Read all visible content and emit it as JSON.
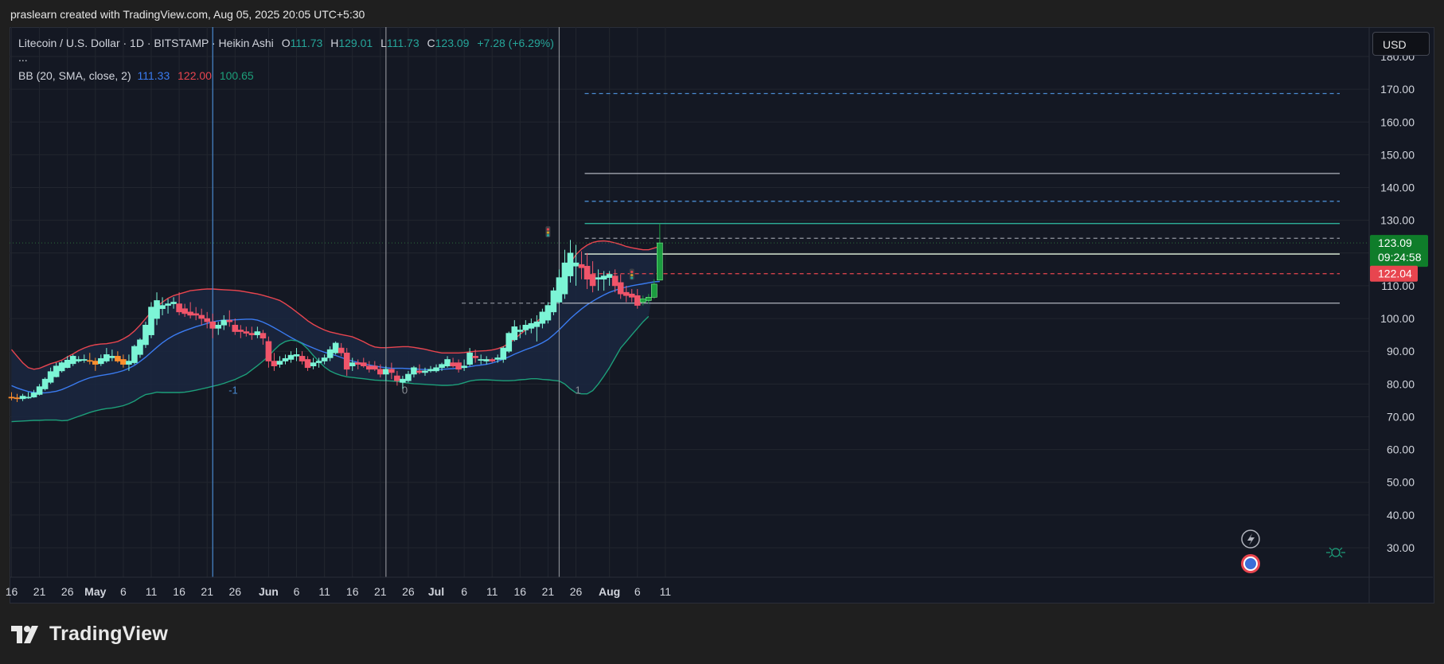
{
  "header": {
    "credit": "praslearn created with TradingView.com, Aug 05, 2025 20:05 UTC+5:30"
  },
  "legend": {
    "symbol": "Litecoin / U.S. Dollar · 1D · BITSTAMP · Heikin Ashi",
    "o_label": "O",
    "o": "111.73",
    "h_label": "H",
    "h": "129.01",
    "l_label": "L",
    "l": "111.73",
    "c_label": "C",
    "c": "123.09",
    "change": "+7.28 (+6.29%)",
    "more": "...",
    "bb_label": "BB (20, SMA, close, 2)",
    "bb_basis": "111.33",
    "bb_upper": "122.00",
    "bb_lower": "100.65"
  },
  "currency_button": "USD",
  "price_badges": {
    "last": "123.09",
    "countdown": "09:24:58",
    "upper": "122.04"
  },
  "brand": "TradingView",
  "colors": {
    "bg": "#141823",
    "up": "#7cf5d6",
    "down": "#f0556a",
    "up_strong": "#1b9c3f",
    "orange": "#ff8f2e",
    "bb_upper": "#e8454f",
    "bb_basis": "#3a7bf0",
    "bb_lower": "#1d9f7a",
    "badge_green": "#0f7d2a",
    "badge_red": "#e8454f"
  },
  "chart_data": {
    "type": "candlestick",
    "chart_style": "Heikin Ashi",
    "ylim": [
      21,
      189
    ],
    "y_ticks": [
      "30.00",
      "40.00",
      "50.00",
      "60.00",
      "70.00",
      "80.00",
      "90.00",
      "100.00",
      "110.00",
      "120.00",
      "130.00",
      "140.00",
      "150.00",
      "160.00",
      "170.00",
      "180.00"
    ],
    "x_ticks": [
      "16",
      "21",
      "26",
      "May",
      "6",
      "11",
      "16",
      "21",
      "26",
      "Jun",
      "6",
      "11",
      "16",
      "21",
      "26",
      "Jul",
      "6",
      "11",
      "16",
      "21",
      "26",
      "Aug",
      "6",
      "11"
    ],
    "x_tick_dates": [
      "2025-04-16",
      "2025-04-21",
      "2025-04-26",
      "2025-05-01",
      "2025-05-06",
      "2025-05-11",
      "2025-05-16",
      "2025-05-21",
      "2025-05-26",
      "2025-06-01",
      "2025-06-06",
      "2025-06-11",
      "2025-06-16",
      "2025-06-21",
      "2025-06-26",
      "2025-07-01",
      "2025-07-06",
      "2025-07-11",
      "2025-07-16",
      "2025-07-21",
      "2025-07-26",
      "2025-08-01",
      "2025-08-06",
      "2025-08-11"
    ],
    "first_date": "2025-04-16",
    "candles": [
      [
        76.0,
        77.5,
        75.0,
        75.8
      ],
      [
        75.8,
        77.0,
        74.5,
        75.5
      ],
      [
        75.5,
        77.0,
        74.8,
        76.3
      ],
      [
        76.0,
        77.5,
        75.5,
        76.0
      ],
      [
        76.0,
        78.2,
        75.8,
        77.3
      ],
      [
        76.8,
        80.0,
        76.5,
        79.2
      ],
      [
        78.5,
        82.0,
        78.0,
        81.5
      ],
      [
        80.5,
        85.0,
        80.0,
        83.8
      ],
      [
        82.2,
        86.5,
        82.0,
        85.5
      ],
      [
        84.0,
        87.0,
        83.5,
        86.5
      ],
      [
        85.0,
        88.5,
        84.8,
        87.3
      ],
      [
        86.2,
        89.0,
        85.5,
        88.5
      ],
      [
        87.0,
        88.5,
        86.5,
        87.5
      ],
      [
        87.5,
        89.0,
        86.5,
        87.5
      ],
      [
        87.2,
        89.5,
        86.0,
        87.0
      ],
      [
        87.0,
        88.0,
        84.0,
        86.0
      ],
      [
        86.2,
        89.0,
        85.5,
        87.8
      ],
      [
        87.0,
        91.0,
        86.5,
        89.0
      ],
      [
        88.0,
        90.5,
        87.0,
        88.5
      ],
      [
        88.5,
        90.0,
        86.5,
        87.0
      ],
      [
        87.5,
        89.0,
        85.0,
        86.0
      ],
      [
        86.0,
        89.0,
        84.0,
        87.0
      ],
      [
        86.5,
        92.0,
        86.0,
        91.5
      ],
      [
        89.0,
        94.0,
        88.0,
        93.5
      ],
      [
        92.0,
        99.0,
        91.0,
        98.0
      ],
      [
        95.0,
        105.0,
        94.0,
        103.5
      ],
      [
        100.0,
        108.0,
        98.0,
        105.5
      ],
      [
        103.0,
        106.5,
        101.0,
        104.0
      ],
      [
        104.0,
        106.0,
        101.5,
        104.5
      ],
      [
        104.5,
        106.5,
        103.0,
        105.0
      ],
      [
        104.5,
        108.0,
        101.0,
        102.0
      ],
      [
        103.0,
        104.5,
        100.5,
        101.5
      ],
      [
        102.0,
        105.0,
        100.0,
        101.0
      ],
      [
        101.5,
        103.5,
        99.5,
        101.0
      ],
      [
        101.0,
        103.0,
        98.0,
        100.0
      ],
      [
        100.0,
        102.0,
        97.0,
        99.0
      ],
      [
        99.0,
        101.5,
        94.0,
        97.0
      ],
      [
        97.0,
        99.0,
        95.0,
        98.0
      ],
      [
        98.0,
        101.0,
        96.5,
        99.5
      ],
      [
        99.5,
        102.5,
        97.5,
        99.0
      ],
      [
        98.0,
        100.0,
        95.0,
        96.0
      ],
      [
        96.5,
        98.0,
        94.0,
        96.0
      ],
      [
        96.0,
        97.5,
        94.5,
        95.5
      ],
      [
        95.5,
        97.5,
        93.5,
        95.0
      ],
      [
        95.0,
        97.5,
        94.0,
        96.0
      ],
      [
        95.5,
        96.5,
        92.0,
        94.0
      ],
      [
        93.0,
        94.5,
        85.0,
        87.0
      ],
      [
        87.0,
        89.5,
        84.0,
        85.5
      ],
      [
        86.0,
        88.5,
        85.0,
        87.0
      ],
      [
        87.0,
        89.0,
        86.0,
        87.8
      ],
      [
        87.5,
        90.0,
        86.5,
        88.8
      ],
      [
        88.5,
        91.0,
        87.0,
        89.0
      ],
      [
        88.5,
        90.0,
        86.0,
        87.0
      ],
      [
        87.5,
        88.5,
        84.0,
        85.0
      ],
      [
        85.5,
        88.0,
        84.5,
        86.5
      ],
      [
        86.5,
        88.0,
        85.0,
        87.0
      ],
      [
        87.0,
        89.0,
        86.0,
        88.0
      ],
      [
        88.0,
        91.5,
        87.0,
        90.5
      ],
      [
        89.5,
        93.0,
        89.0,
        92.5
      ],
      [
        91.0,
        92.5,
        88.5,
        89.5
      ],
      [
        89.5,
        91.0,
        82.5,
        84.5
      ],
      [
        85.5,
        88.0,
        84.0,
        86.5
      ],
      [
        86.5,
        87.5,
        84.5,
        86.0
      ],
      [
        86.5,
        88.0,
        85.0,
        85.5
      ],
      [
        85.5,
        87.0,
        83.5,
        84.5
      ],
      [
        85.5,
        87.0,
        84.0,
        84.5
      ],
      [
        84.5,
        86.0,
        82.0,
        83.0
      ],
      [
        83.0,
        85.5,
        81.0,
        84.5
      ],
      [
        84.5,
        86.5,
        81.5,
        83.5
      ],
      [
        82.5,
        84.0,
        79.5,
        81.0
      ],
      [
        80.5,
        82.5,
        78.5,
        81.5
      ],
      [
        81.0,
        84.0,
        80.5,
        83.0
      ],
      [
        83.0,
        85.5,
        82.0,
        85.0
      ],
      [
        84.0,
        86.0,
        83.0,
        83.5
      ],
      [
        83.5,
        85.0,
        82.5,
        84.0
      ],
      [
        84.0,
        85.5,
        83.5,
        84.5
      ],
      [
        84.0,
        86.0,
        83.5,
        85.0
      ],
      [
        85.0,
        86.5,
        84.0,
        86.0
      ],
      [
        85.5,
        88.5,
        85.0,
        87.5
      ],
      [
        86.5,
        88.0,
        85.0,
        85.5
      ],
      [
        86.5,
        87.5,
        83.5,
        84.5
      ],
      [
        85.0,
        87.5,
        84.0,
        85.5
      ],
      [
        86.0,
        91.0,
        85.5,
        89.5
      ],
      [
        88.5,
        90.5,
        86.5,
        88.0
      ],
      [
        87.5,
        89.0,
        86.0,
        87.5
      ],
      [
        87.0,
        88.5,
        86.0,
        87.5
      ],
      [
        87.5,
        88.0,
        86.5,
        87.0
      ],
      [
        87.5,
        89.0,
        86.5,
        88.0
      ],
      [
        87.5,
        91.5,
        86.5,
        91.0
      ],
      [
        90.0,
        96.0,
        89.5,
        95.5
      ],
      [
        93.5,
        99.5,
        93.0,
        97.5
      ],
      [
        96.0,
        98.0,
        94.0,
        96.5
      ],
      [
        96.5,
        99.5,
        95.0,
        98.0
      ],
      [
        97.0,
        100.0,
        95.5,
        98.5
      ],
      [
        97.5,
        101.0,
        93.0,
        99.0
      ],
      [
        98.5,
        103.0,
        97.0,
        102.0
      ],
      [
        99.5,
        105.0,
        98.5,
        104.0
      ],
      [
        102.0,
        109.5,
        101.0,
        108.5
      ],
      [
        105.0,
        115.0,
        104.5,
        112.5
      ],
      [
        107.5,
        121.0,
        106.0,
        117.0
      ],
      [
        113.0,
        124.0,
        111.0,
        120.0
      ],
      [
        116.0,
        122.5,
        110.0,
        117.0
      ],
      [
        116.5,
        120.5,
        112.0,
        115.5
      ],
      [
        116.0,
        120.0,
        109.0,
        112.0
      ],
      [
        113.5,
        117.5,
        108.0,
        110.0
      ],
      [
        112.0,
        115.0,
        108.5,
        112.5
      ],
      [
        112.0,
        114.5,
        108.5,
        113.0
      ],
      [
        112.5,
        114.5,
        110.0,
        113.5
      ],
      [
        113.0,
        115.0,
        108.0,
        110.0
      ],
      [
        111.0,
        113.5,
        106.0,
        107.5
      ],
      [
        108.0,
        110.0,
        105.0,
        107.0
      ],
      [
        107.5,
        109.0,
        105.0,
        106.5
      ],
      [
        107.0,
        109.0,
        103.0,
        104.0
      ],
      [
        105.0,
        107.0,
        104.0,
        106.0
      ],
      [
        105.5,
        107.5,
        104.5,
        106.5
      ],
      [
        106.5,
        112.0,
        106.0,
        110.5
      ],
      [
        111.73,
        129.01,
        111.73,
        123.09
      ]
    ],
    "bb_upper": [
      90.5,
      88.5,
      86.5,
      85,
      84.5,
      84.8,
      85.5,
      86.2,
      86.7,
      87.3,
      88.3,
      89.2,
      90.2,
      91,
      91.6,
      92,
      92.2,
      92.3,
      92.6,
      93,
      93.8,
      94.8,
      96.2,
      98,
      100,
      102,
      103.6,
      105,
      106.2,
      107,
      107.5,
      108,
      108.5,
      108.7,
      108.9,
      109.0,
      109.0,
      108.9,
      108.8,
      108.7,
      108.6,
      108.4,
      108.1,
      107.8,
      107.5,
      107.1,
      106.6,
      106.1,
      105.5,
      104.5,
      103.3,
      102.0,
      100.7,
      99.3,
      98.2,
      97.3,
      96.5,
      95.9,
      95.5,
      95.1,
      94.8,
      94.4,
      93.7,
      92.9,
      92.0,
      91.3,
      91.1,
      91.1,
      91.2,
      91.3,
      91.4,
      91.4,
      91.2,
      90.9,
      90.6,
      90.2,
      89.8,
      89.5,
      89.5,
      89.5,
      89.5,
      89.6,
      89.8,
      90.0,
      90.1,
      90.2,
      90.4,
      90.8,
      91.4,
      92.4,
      93.7,
      95.2,
      96.5,
      97.7,
      99.0,
      100.6,
      102.5,
      105.0,
      109.0,
      113.5,
      117.0,
      119.5,
      121.2,
      122.4,
      123.2,
      123.6,
      123.7,
      123.5,
      123.1,
      122.6,
      122.0,
      121.6,
      121.3,
      121.0,
      121.0,
      121.5,
      122.0
    ],
    "bb_basis": [
      79.5,
      78.8,
      78.2,
      77.7,
      77.4,
      77.3,
      77.3,
      77.5,
      77.8,
      78.3,
      79.0,
      79.8,
      80.6,
      81.3,
      81.9,
      82.3,
      82.6,
      82.9,
      83.2,
      83.6,
      84.1,
      84.8,
      85.7,
      86.9,
      88.2,
      89.7,
      91.2,
      92.6,
      93.8,
      94.8,
      95.6,
      96.3,
      96.9,
      97.5,
      98.0,
      98.5,
      99.0,
      99.3,
      99.5,
      99.5,
      99.6,
      99.7,
      99.8,
      99.8,
      99.5,
      98.9,
      98.1,
      97.2,
      96.2,
      95.2,
      94.2,
      93.3,
      92.5,
      91.7,
      91.0,
      90.3,
      89.7,
      89.2,
      88.7,
      88.1,
      87.5,
      87.0,
      86.6,
      86.2,
      85.8,
      85.5,
      85.2,
      85.0,
      84.8,
      84.8,
      84.8,
      84.7,
      84.6,
      84.5,
      84.4,
      84.4,
      84.4,
      84.5,
      84.6,
      84.7,
      84.9,
      85.1,
      85.3,
      85.6,
      85.8,
      86.0,
      86.4,
      86.9,
      87.6,
      88.3,
      89.1,
      89.8,
      90.5,
      91.1,
      91.8,
      92.6,
      93.6,
      95.0,
      96.6,
      98.3,
      100.0,
      101.5,
      102.9,
      104.2,
      105.3,
      106.3,
      107.2,
      108.0,
      108.6,
      109.2,
      109.6,
      110.0,
      110.3,
      110.6,
      110.9,
      111.2,
      111.33
    ],
    "bb_lower": [
      68.5,
      68.6,
      68.7,
      68.8,
      68.9,
      68.9,
      69.0,
      69.0,
      69.0,
      68.8,
      68.9,
      69.5,
      70.1,
      70.7,
      71.3,
      71.8,
      72.2,
      72.5,
      72.7,
      73.0,
      73.4,
      74.0,
      74.8,
      75.9,
      76.8,
      77.1,
      77.5,
      77.4,
      77.4,
      77.4,
      77.4,
      77.5,
      77.8,
      78.1,
      78.5,
      78.9,
      79.3,
      79.7,
      80.2,
      80.8,
      81.4,
      82.2,
      83.0,
      84.3,
      85.6,
      87.0,
      88.5,
      90.4,
      92.0,
      93.0,
      93.4,
      93.2,
      92.3,
      90.7,
      88.7,
      86.9,
      85.2,
      84.0,
      83.2,
      82.6,
      82.2,
      82.0,
      81.8,
      81.6,
      81.4,
      81.2,
      81.1,
      81.0,
      80.9,
      80.8,
      80.5,
      80.3,
      80.1,
      80.0,
      79.9,
      79.8,
      79.7,
      79.6,
      79.6,
      79.7,
      79.9,
      80.4,
      80.9,
      81.2,
      81.3,
      81.3,
      81.2,
      81.1,
      81.0,
      81.0,
      81.1,
      81.3,
      81.4,
      81.6,
      81.6,
      81.4,
      81.3,
      81.1,
      80.9,
      80.0,
      78.5,
      77.3,
      77.0,
      77.0,
      78.0,
      80.0,
      82.4,
      85.0,
      88.0,
      91.0,
      93.0,
      95.0,
      97.0,
      99.0,
      100.65
    ],
    "hlines": [
      {
        "y": 144.3,
        "style": "solid",
        "color": "#b0b3bd",
        "from_index": 103
      },
      {
        "y": 129.0,
        "style": "solid",
        "color": "#2fc1a7",
        "from_index": 103
      },
      {
        "y": 119.7,
        "style": "solid",
        "color": "#e6f7e0",
        "from_index": 103
      },
      {
        "y": 104.7,
        "style": "solid",
        "color": "#b0b3bd",
        "from_index": 99
      },
      {
        "y": 168.7,
        "style": "dashed",
        "color": "#4a8bd1",
        "from_index": 103
      },
      {
        "y": 135.8,
        "style": "dashed",
        "color": "#4a8bd1",
        "from_index": 103
      },
      {
        "y": 124.5,
        "style": "dashed",
        "color": "#888c96",
        "from_index": 103
      },
      {
        "y": 113.7,
        "style": "dashed",
        "color": "#e8454f",
        "from_index": 103
      },
      {
        "y": 104.7,
        "style": "dashed",
        "color": "#888c96",
        "from_index": 81,
        "to_index": 99
      }
    ],
    "vlines": [
      {
        "date": "2025-05-22",
        "color": "#4a8bd1",
        "label": "-1"
      },
      {
        "date": "2025-06-22",
        "color": "#8a8d94",
        "label": "0"
      },
      {
        "date": "2025-07-23",
        "color": "#8a8d94",
        "label": "1"
      }
    ]
  }
}
